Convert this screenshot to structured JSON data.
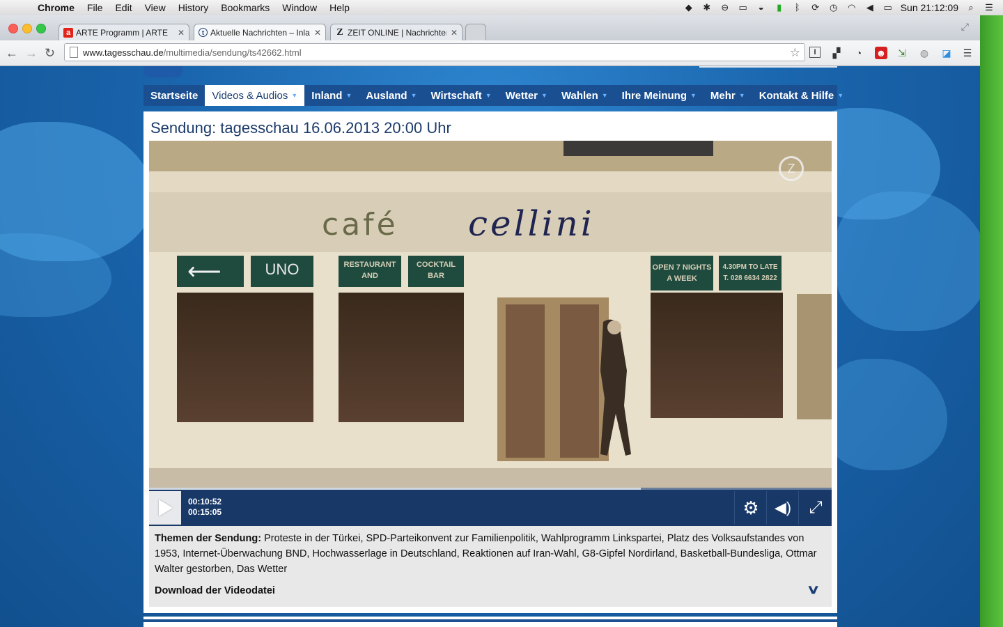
{
  "menubar": {
    "app": "Chrome",
    "items": [
      "File",
      "Edit",
      "View",
      "History",
      "Bookmarks",
      "Window",
      "Help"
    ],
    "clock": "Sun 21:12:09"
  },
  "tabs": [
    {
      "title": "ARTE Programm | ARTE",
      "fav": "a",
      "fav_color": "#e2231a"
    },
    {
      "title": "Aktuelle Nachrichten – Inla",
      "fav": "t",
      "fav_color": "#1a3d73"
    },
    {
      "title": "ZEIT ONLINE | Nachrichten",
      "fav": "Z",
      "fav_color": "#000000"
    }
  ],
  "omnibox": {
    "host": "www.tagesschau.de",
    "path": "/multimedia/sendung/ts42662.html"
  },
  "nav": {
    "items": [
      {
        "label": "Startseite",
        "caret": false
      },
      {
        "label": "Videos & Audios",
        "caret": true,
        "active": true
      },
      {
        "label": "Inland",
        "caret": true
      },
      {
        "label": "Ausland",
        "caret": true
      },
      {
        "label": "Wirtschaft",
        "caret": true
      },
      {
        "label": "Wetter",
        "caret": true
      },
      {
        "label": "Wahlen",
        "caret": true
      },
      {
        "label": "Ihre Meinung",
        "caret": true
      },
      {
        "label": "Mehr",
        "caret": true
      },
      {
        "label": "Kontakt & Hilfe",
        "caret": true
      }
    ]
  },
  "page": {
    "title": "Sendung: tagesschau 16.06.2013 20:00 Uhr"
  },
  "video": {
    "sign_left": "café",
    "sign_right": "cellini",
    "panel_uno": "UNO",
    "panel_restaurant": "RESTAURANT AND",
    "panel_cocktail": "COCKTAIL BAR",
    "panel_open": "OPEN 7 NIGHTS A WEEK",
    "panel_late": "4.30PM TO LATE T. 028 6634 2822",
    "current_time": "00:10:52",
    "duration": "00:15:05",
    "progress": 0.72
  },
  "info": {
    "themen_label": "Themen der Sendung:",
    "themen_text": " Proteste in der Türkei, SPD-Parteikonvent zur Familienpolitik, Wahlprogramm Linkspartei, Platz des Volksaufstandes von 1953, Internet-Überwachung BND, Hochwasserlage in Deutschland, Reaktionen auf Iran-Wahl, G8-Gipfel Nordirland, Basketball-Bundesliga, Ottmar Walter gestorben, Das Wetter",
    "download_label": "Download der Videodatei"
  }
}
